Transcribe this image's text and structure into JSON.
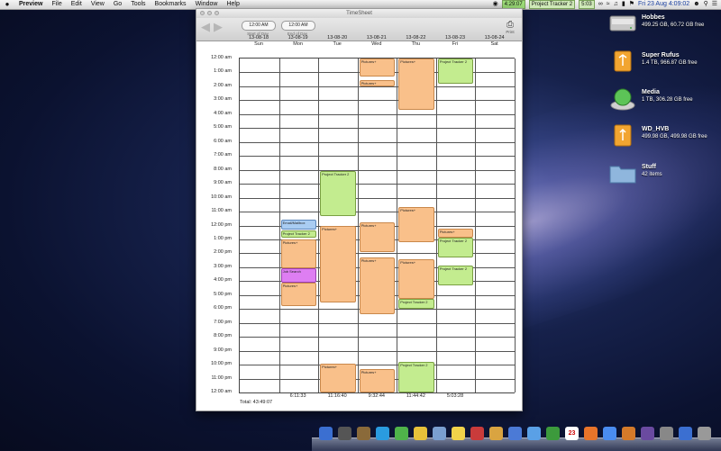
{
  "menubar": {
    "apple": "",
    "app_name": "Preview",
    "items": [
      "File",
      "Edit",
      "View",
      "Go",
      "Tools",
      "Bookmarks",
      "Window",
      "Help"
    ],
    "timer_text": "4:29:07",
    "timer_project": "Project Tracker 2",
    "timer_small": "5:03",
    "datetime": "Fri 23 Aug  4:09:02"
  },
  "window": {
    "title": "TimeSheet",
    "start_time": "12:00 AM",
    "start_caption": "Start of Day",
    "end_time": "12:00 AM",
    "end_caption": "End of Day",
    "print_label": "Print"
  },
  "days": [
    {
      "date": "13-08-18",
      "name": "Sun",
      "total": ""
    },
    {
      "date": "13-08-19",
      "name": "Mon",
      "total": "6:11:33"
    },
    {
      "date": "13-08-20",
      "name": "Tue",
      "total": "11:16:40"
    },
    {
      "date": "13-08-21",
      "name": "Wed",
      "total": "9:32:44"
    },
    {
      "date": "13-08-22",
      "name": "Thu",
      "total": "11:44:42"
    },
    {
      "date": "13-08-23",
      "name": "Fri",
      "total": "5:03:28"
    },
    {
      "date": "13-08-24",
      "name": "Sat",
      "total": ""
    }
  ],
  "grand_total": "Total: 43:49:07",
  "hour_labels": [
    "12:00 am",
    "1:00 am",
    "2:00 am",
    "3:00 am",
    "4:00 am",
    "5:00 am",
    "6:00 am",
    "7:00 am",
    "8:00 am",
    "9:00 am",
    "10:00 am",
    "11:00 am",
    "12:00 pm",
    "1:00 pm",
    "2:00 pm",
    "3:00 pm",
    "4:00 pm",
    "5:00 pm",
    "6:00 pm",
    "7:00 pm",
    "8:00 pm",
    "9:00 pm",
    "10:00 pm",
    "11:00 pm",
    "12:00 am"
  ],
  "events": [
    {
      "day": 1,
      "start": 11.6,
      "end": 12.3,
      "label": "Email/Mailbox",
      "color": "blue"
    },
    {
      "day": 1,
      "start": 12.35,
      "end": 12.9,
      "label": "Project Tracker 2",
      "color": "green"
    },
    {
      "day": 1,
      "start": 13.0,
      "end": 15.1,
      "label": "Pictures+",
      "color": "orange"
    },
    {
      "day": 1,
      "start": 15.1,
      "end": 16.1,
      "label": "Job Search",
      "color": "purple"
    },
    {
      "day": 1,
      "start": 16.1,
      "end": 17.8,
      "label": "Pictures+",
      "color": "orange"
    },
    {
      "day": 2,
      "start": 8.1,
      "end": 11.3,
      "label": "Project Tracker 2",
      "color": "green"
    },
    {
      "day": 2,
      "start": 12.0,
      "end": 17.5,
      "label": "Pictures+",
      "color": "orange"
    },
    {
      "day": 2,
      "start": 21.9,
      "end": 24.0,
      "label": "Pictures+",
      "color": "orange"
    },
    {
      "day": 3,
      "start": 0.0,
      "end": 1.3,
      "label": "Pictures+",
      "color": "orange"
    },
    {
      "day": 3,
      "start": 1.55,
      "end": 2.0,
      "label": "Pictures+",
      "color": "orange"
    },
    {
      "day": 3,
      "start": 11.8,
      "end": 13.9,
      "label": "Pictures+",
      "color": "orange"
    },
    {
      "day": 3,
      "start": 14.3,
      "end": 18.4,
      "label": "Pictures+",
      "color": "orange"
    },
    {
      "day": 3,
      "start": 22.3,
      "end": 24.0,
      "label": "Pictures+",
      "color": "orange"
    },
    {
      "day": 4,
      "start": 0.0,
      "end": 3.7,
      "label": "Pictures+",
      "color": "orange"
    },
    {
      "day": 4,
      "start": 10.7,
      "end": 13.2,
      "label": "Pictures+",
      "color": "orange"
    },
    {
      "day": 4,
      "start": 14.4,
      "end": 17.3,
      "label": "Pictures+",
      "color": "orange"
    },
    {
      "day": 4,
      "start": 17.3,
      "end": 18.0,
      "label": "Project Tracker 2",
      "color": "green"
    },
    {
      "day": 4,
      "start": 21.8,
      "end": 24.0,
      "label": "Project Tracker 2",
      "color": "green"
    },
    {
      "day": 5,
      "start": 0.0,
      "end": 1.8,
      "label": "Project Tracker 2",
      "color": "green"
    },
    {
      "day": 5,
      "start": 12.2,
      "end": 12.9,
      "label": "Pictures+",
      "color": "orange"
    },
    {
      "day": 5,
      "start": 12.9,
      "end": 14.3,
      "label": "Project Tracker 2",
      "color": "green"
    },
    {
      "day": 5,
      "start": 14.9,
      "end": 16.3,
      "label": "Project Tracker 2",
      "color": "green"
    }
  ],
  "colors": {
    "orange": "#f9c08a",
    "green": "#c3ec8f",
    "blue": "#a9ccf2",
    "purple": "#de7ef2"
  },
  "drives": [
    {
      "name": "Hobbes",
      "info": "499.25 GB, 60.72 GB free",
      "icon": "hard-drive-icon"
    },
    {
      "name": "Super Rufus",
      "info": "1.4 TB, 966.87 GB free",
      "icon": "external-drive-icon"
    },
    {
      "name": "Media",
      "info": "1 TB, 306.28 GB free",
      "icon": "media-drive-icon"
    },
    {
      "name": "WD_HVB",
      "info": "499.98 GB, 499.98 GB free",
      "icon": "usb-drive-icon"
    },
    {
      "name": "Stuff",
      "info": "42 items",
      "icon": "folder-icon"
    }
  ],
  "dock_icons": [
    "finder-icon",
    "launchpad-icon",
    "contacts-icon",
    "app-store-icon",
    "maps-icon",
    "notes-icon",
    "preview-icon",
    "stickies-icon",
    "calendar-icon",
    "photos-icon",
    "itunes-icon",
    "messages-icon",
    "facetime-icon",
    "calendar-date-icon",
    "firefox-icon",
    "chrome-icon",
    "ibooks-icon",
    "game-icon",
    "settings-icon",
    "finder-alt-icon",
    "trash-icon"
  ],
  "dock_calendar_day": "23"
}
